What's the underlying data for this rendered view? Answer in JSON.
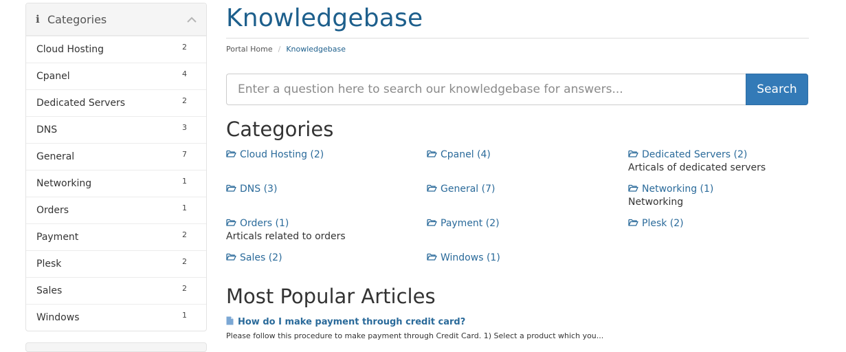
{
  "sidebar": {
    "title": "Categories",
    "items": [
      {
        "label": "Cloud Hosting",
        "count": "2"
      },
      {
        "label": "Cpanel",
        "count": "4"
      },
      {
        "label": "Dedicated Servers",
        "count": "2"
      },
      {
        "label": "DNS",
        "count": "3"
      },
      {
        "label": "General",
        "count": "7"
      },
      {
        "label": "Networking",
        "count": "1"
      },
      {
        "label": "Orders",
        "count": "1"
      },
      {
        "label": "Payment",
        "count": "2"
      },
      {
        "label": "Plesk",
        "count": "2"
      },
      {
        "label": "Sales",
        "count": "2"
      },
      {
        "label": "Windows",
        "count": "1"
      }
    ]
  },
  "page": {
    "title": "Knowledgebase",
    "breadcrumb": [
      "Portal Home",
      "Knowledgebase"
    ]
  },
  "search": {
    "placeholder": "Enter a question here to search our knowledgebase for answers...",
    "value": "",
    "button_label": "Search"
  },
  "categories": {
    "heading": "Categories",
    "items": [
      {
        "label": "Cloud Hosting (2)",
        "description": ""
      },
      {
        "label": "Cpanel (4)",
        "description": ""
      },
      {
        "label": "Dedicated Servers (2)",
        "description": "Articals of dedicated servers"
      },
      {
        "label": "DNS (3)",
        "description": ""
      },
      {
        "label": "General (7)",
        "description": ""
      },
      {
        "label": "Networking (1)",
        "description": "Networking"
      },
      {
        "label": "Orders (1)",
        "description": "Articals related to orders"
      },
      {
        "label": "Payment (2)",
        "description": ""
      },
      {
        "label": "Plesk (2)",
        "description": ""
      },
      {
        "label": "Sales (2)",
        "description": ""
      },
      {
        "label": "Windows (1)",
        "description": ""
      }
    ]
  },
  "popular": {
    "heading": "Most Popular Articles",
    "articles": [
      {
        "title": "How do I make payment through credit card?",
        "snippet": "Please follow this procedure to make payment through Credit Card. 1) Select a product which you..."
      }
    ]
  },
  "colors": {
    "accent": "#1d5f8c",
    "link": "#2a6a9a",
    "button": "#337ab7",
    "file_icon": "#7ba7d4"
  },
  "icons": {
    "sidebar_header": "info-icon",
    "sidebar_toggle": "chevron-up-icon",
    "category": "folder-open-icon",
    "article": "file-icon"
  }
}
